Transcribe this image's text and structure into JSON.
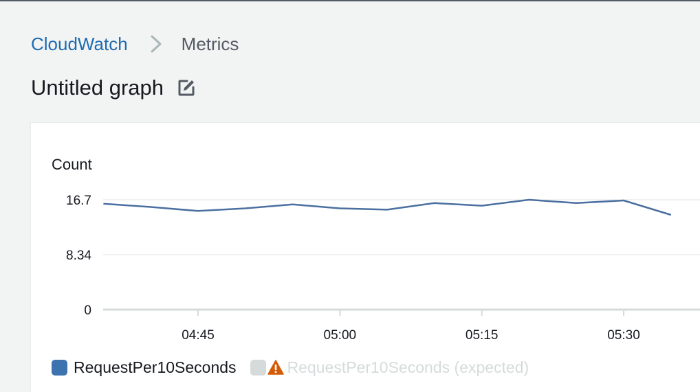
{
  "breadcrumb": {
    "root": "CloudWatch",
    "current": "Metrics"
  },
  "header": {
    "title": "Untitled graph",
    "edit_icon": "edit-icon"
  },
  "colors": {
    "link": "#1f6bb1",
    "series": "#4a6fa0",
    "series_swatch": "#3d74b0",
    "inactive": "#d5dbdb",
    "warning": "#d45b07",
    "inactive_text": "#d5dbdb"
  },
  "chart_data": {
    "type": "line",
    "title": "",
    "ylabel": "Count",
    "xlabel": "",
    "ylim": [
      0,
      16.7
    ],
    "yticks": [
      "16.7",
      "8.34",
      "0"
    ],
    "ytick_values": [
      16.7,
      8.34,
      0
    ],
    "xticks": [
      "04:45",
      "05:00",
      "05:15",
      "05:30"
    ],
    "xtick_values": [
      "04:45",
      "05:00",
      "05:15",
      "05:30"
    ],
    "xlim": [
      "04:35",
      "05:37"
    ],
    "grid": true,
    "legend_position": "bottom-left",
    "series": [
      {
        "name": "RequestPer10Seconds",
        "x": [
          "04:35",
          "04:40",
          "04:45",
          "04:50",
          "04:55",
          "05:00",
          "05:05",
          "05:10",
          "05:15",
          "05:20",
          "05:25",
          "05:30",
          "05:35"
        ],
        "values": [
          16.1,
          15.6,
          15.0,
          15.4,
          16.0,
          15.4,
          15.2,
          16.2,
          15.8,
          16.7,
          16.2,
          16.6,
          14.4
        ]
      }
    ]
  },
  "legend": {
    "items": [
      {
        "label": "RequestPer10Seconds",
        "active": true
      },
      {
        "label": "RequestPer10Seconds (expected)",
        "active": false,
        "icon": "warning-icon"
      }
    ]
  }
}
